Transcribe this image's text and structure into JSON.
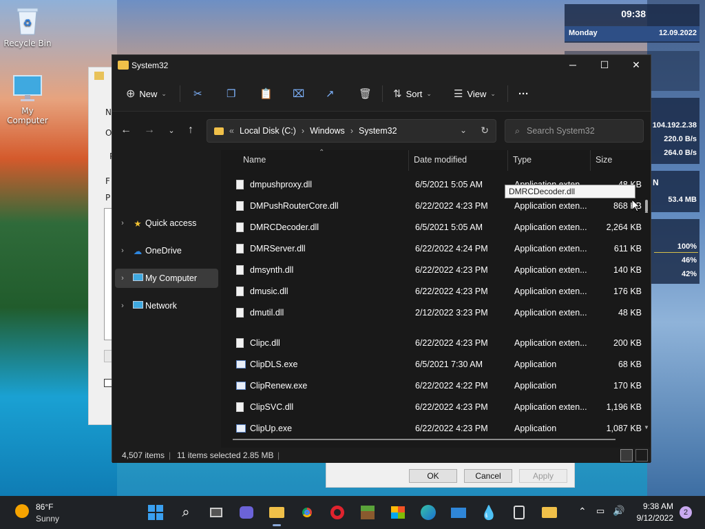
{
  "desktop": {
    "icons": [
      {
        "label": "Recycle Bin",
        "icon": "recycle-bin-icon"
      },
      {
        "label": "My Computer",
        "icon": "monitor-icon"
      }
    ]
  },
  "widgets": {
    "clock": {
      "time": "09:38",
      "day": "Monday",
      "date": "12.09.2022"
    },
    "network": {
      "ip": "104.192.2.38",
      "down": "220.0 B/s",
      "up": "264.0 B/s"
    },
    "memory": {
      "label": "N",
      "value": "53.4 MB"
    },
    "cpu": {
      "v1": "100%",
      "v2": "46%",
      "v3": "42%"
    }
  },
  "back_dialog": {
    "side_labels": [
      "N",
      "O",
      "P",
      "F",
      "P"
    ],
    "ok": "OK",
    "cancel": "Cancel",
    "apply": "Apply"
  },
  "explorer": {
    "title": "System32",
    "toolbar": {
      "new_label": "New",
      "sort_label": "Sort",
      "view_label": "View",
      "more_label": "···"
    },
    "address": {
      "prefix": "«",
      "crumbs": [
        "Local Disk (C:)",
        "Windows",
        "System32"
      ]
    },
    "search": {
      "placeholder": "Search System32"
    },
    "nav": [
      {
        "label": "Quick access",
        "icon": "star-icon",
        "selected": false
      },
      {
        "label": "OneDrive",
        "icon": "cloud-icon",
        "selected": false
      },
      {
        "label": "My Computer",
        "icon": "monitor-icon",
        "selected": true
      },
      {
        "label": "Network",
        "icon": "network-icon",
        "selected": false
      }
    ],
    "columns": [
      "Name",
      "Date modified",
      "Type",
      "Size"
    ],
    "files": [
      {
        "name": "dmpushproxy.dll",
        "date": "6/5/2021 5:05 AM",
        "type": "Application exten...",
        "size": "48 KB",
        "kind": "dll"
      },
      {
        "name": "DMPushRouterCore.dll",
        "date": "6/22/2022 4:23 PM",
        "type": "Application exten...",
        "size": "868 KB",
        "kind": "dll"
      },
      {
        "name": "DMRCDecoder.dll",
        "date": "6/5/2021 5:05 AM",
        "type": "Application exten...",
        "size": "2,264 KB",
        "kind": "dll"
      },
      {
        "name": "DMRServer.dll",
        "date": "6/22/2022 4:24 PM",
        "type": "Application exten...",
        "size": "611 KB",
        "kind": "dll"
      },
      {
        "name": "dmsynth.dll",
        "date": "6/22/2022 4:23 PM",
        "type": "Application exten...",
        "size": "140 KB",
        "kind": "dll"
      },
      {
        "name": "dmusic.dll",
        "date": "6/22/2022 4:23 PM",
        "type": "Application exten...",
        "size": "176 KB",
        "kind": "dll"
      },
      {
        "name": "dmutil.dll",
        "date": "2/12/2022 3:23 PM",
        "type": "Application exten...",
        "size": "48 KB",
        "kind": "dll"
      },
      {
        "name": "Clipc.dll",
        "date": "6/22/2022 4:23 PM",
        "type": "Application exten...",
        "size": "200 KB",
        "kind": "dll"
      },
      {
        "name": "ClipDLS.exe",
        "date": "6/5/2021 7:30 AM",
        "type": "Application",
        "size": "68 KB",
        "kind": "exe"
      },
      {
        "name": "ClipRenew.exe",
        "date": "6/22/2022 4:22 PM",
        "type": "Application",
        "size": "170 KB",
        "kind": "exe"
      },
      {
        "name": "ClipSVC.dll",
        "date": "6/22/2022 4:23 PM",
        "type": "Application exten...",
        "size": "1,196 KB",
        "kind": "dll"
      },
      {
        "name": "ClipUp.exe",
        "date": "6/22/2022 4:23 PM",
        "type": "Application",
        "size": "1,087 KB",
        "kind": "exe"
      }
    ],
    "tooltip": "DMRCDecoder.dll",
    "status": {
      "items": "4,507 items",
      "selected": "11 items selected  2.85 MB"
    }
  },
  "taskbar": {
    "weather": {
      "temp": "86°F",
      "desc": "Sunny"
    },
    "time": "9:38 AM",
    "date": "9/12/2022",
    "notifications": "2"
  }
}
